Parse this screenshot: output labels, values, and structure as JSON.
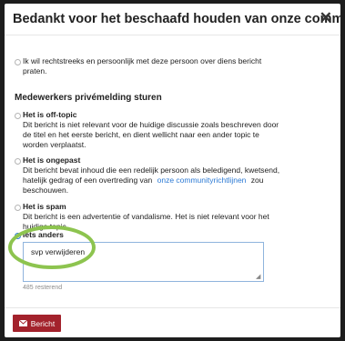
{
  "modal": {
    "title": "Bedankt voor het beschaafd houden van onze community!",
    "close_icon": "✕"
  },
  "direct_message": {
    "label_line1": "Ik wil rechtstreeks en persoonlijk met deze persoon over diens bericht",
    "label_line2": "praten."
  },
  "section": {
    "heading": "Medewerkers privémelding sturen"
  },
  "options": [
    {
      "title": "Het is off-topic",
      "lines": [
        "Dit bericht is niet relevant voor de huidige discussie zoals beschreven door",
        "de titel en het eerste bericht, en dient wellicht naar een ander topic te",
        "worden verplaatst."
      ]
    },
    {
      "title": "Het is ongepast",
      "lines": [
        "Dit bericht bevat inhoud die een redelijk persoon als beledigend, kwetsend,",
        "hatelijk gedrag of een overtreding van"
      ],
      "link": "onze communityrichtlijnen",
      "after_link": "zou",
      "last_line": "beschouwen."
    },
    {
      "title": "Het is spam",
      "lines": [
        "Dit bericht is een advertentie of vandalisme. Het is niet relevant voor het",
        "huidige topic."
      ]
    },
    {
      "title": "Iets anders",
      "selected": true
    }
  ],
  "message": {
    "value": "svp verwijderen",
    "remaining": "485 resterend"
  },
  "footer": {
    "submit_label": "Bericht",
    "submit_icon": "envelope-icon",
    "submit_color": "#a3222c"
  },
  "colors": {
    "accent": "#2c7ad4",
    "highlight": "#8dc44f"
  }
}
